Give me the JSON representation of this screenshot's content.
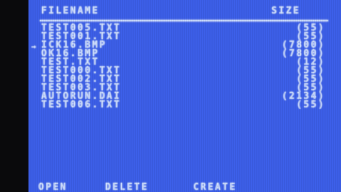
{
  "header": {
    "filename_label": "FILENAME",
    "size_label": "SIZE"
  },
  "cursor": "→",
  "files": [
    {
      "name": "TEST005.TXT",
      "size": "(55)"
    },
    {
      "name": "TEST001.TXT",
      "size": "(55)"
    },
    {
      "name": "ICK16.BMP",
      "size": "(7800)"
    },
    {
      "name": "OK16.BMP",
      "size": "(7800)"
    },
    {
      "name": "TEST.TXT",
      "size": "(12)"
    },
    {
      "name": "TEST000.TXT",
      "size": "(55)"
    },
    {
      "name": "TEST002.TXT",
      "size": "(55)"
    },
    {
      "name": "TEST003.TXT",
      "size": "(55)"
    },
    {
      "name": "AUTORUN.DAI",
      "size": "(2134)"
    },
    {
      "name": "TEST006.TXT",
      "size": "(55)"
    }
  ],
  "selected_index": 5,
  "menu": {
    "open": "OPEN",
    "delete": "DELETE",
    "create": "CREATE"
  },
  "colors": {
    "background": "#3d60ea",
    "text": "#cfe0ff",
    "bezel": "#0a0a0c"
  }
}
